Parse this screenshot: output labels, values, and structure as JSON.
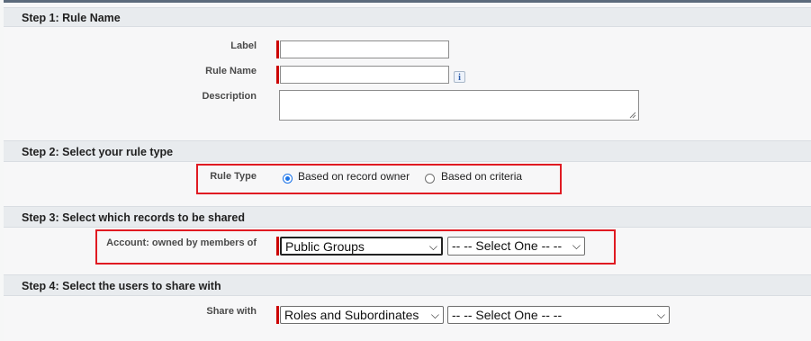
{
  "step1": {
    "title": "Step 1: Rule Name",
    "label_label": "Label",
    "label_value": "",
    "rule_name_label": "Rule Name",
    "rule_name_value": "",
    "info_icon": "i",
    "description_label": "Description",
    "description_value": ""
  },
  "step2": {
    "title": "Step 2: Select your rule type",
    "rule_type_label": "Rule Type",
    "option_owner": "Based on record owner",
    "option_criteria": "Based on criteria",
    "selected": "Based on record owner"
  },
  "step3": {
    "title": "Step 3: Select which records to be shared",
    "owned_by_label": "Account: owned by members of",
    "group_type_selected": "Public Groups",
    "group_selected": "-- -- Select One -- --"
  },
  "step4": {
    "title": "Step 4: Select the users to share with",
    "share_with_label": "Share with",
    "share_type_selected": "Roles and Subordinates",
    "share_target_selected": "-- -- Select One -- --"
  },
  "colors": {
    "required_bar": "#cc0000",
    "highlight_box": "#e01a22",
    "header_bg": "#e8ebee"
  },
  "icons": {
    "info": "info-icon",
    "dropdown": "chevron-down-icon",
    "resize": "resize-handle-icon"
  }
}
